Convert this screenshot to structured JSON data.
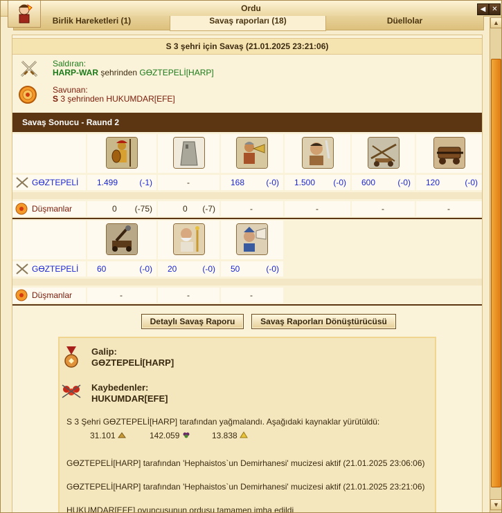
{
  "window": {
    "title": "Ordu"
  },
  "tabs": [
    {
      "label": "Birlik Hareketleri (1)"
    },
    {
      "label": "Savaş raporları (18)"
    },
    {
      "label": "Düellolar"
    }
  ],
  "report": {
    "title": "S 3 şehri için Savaş (21.01.2025 23:21:06)",
    "attacker": {
      "label": "Saldıran:",
      "player": "HARP-WAR",
      "mid": " şehrinden ",
      "target": "GӨZTEPELİ[HARP]"
    },
    "defender": {
      "label": "Savunan:",
      "city": "S",
      "line": " 3 şehrinden HUKUMDAR[EFE]"
    },
    "round_title": "Savaş Sonucu - Raund 2",
    "rows": {
      "player_name": "GӨZTEPELİ",
      "enemies_name": "Düşmanlar"
    },
    "units_row1": [
      {
        "icon": "spearman-icon",
        "own": "1.499",
        "own_loss": "(-1)",
        "enemy": "0",
        "enemy_loss": "(-75)"
      },
      {
        "icon": "wall-icon",
        "own": "-",
        "own_loss": "",
        "enemy": "0",
        "enemy_loss": "(-7)"
      },
      {
        "icon": "hornblower-icon",
        "own": "168",
        "own_loss": "(-0)",
        "enemy": "-",
        "enemy_loss": ""
      },
      {
        "icon": "swordsman-icon",
        "own": "1.500",
        "own_loss": "(-0)",
        "enemy": "-",
        "enemy_loss": ""
      },
      {
        "icon": "ballista-icon",
        "own": "600",
        "own_loss": "(-0)",
        "enemy": "-",
        "enemy_loss": ""
      },
      {
        "icon": "ram-icon",
        "own": "120",
        "own_loss": "(-0)",
        "enemy": "-",
        "enemy_loss": ""
      }
    ],
    "units_row2": [
      {
        "icon": "catapult-icon",
        "own": "60",
        "own_loss": "(-0)",
        "enemy": "-",
        "enemy_loss": ""
      },
      {
        "icon": "oracle-icon",
        "own": "20",
        "own_loss": "(-0)",
        "enemy": "-",
        "enemy_loss": ""
      },
      {
        "icon": "engineer-icon",
        "own": "50",
        "own_loss": "(-0)",
        "enemy": "-",
        "enemy_loss": ""
      }
    ],
    "buttons": {
      "detail": "Detaylı Savaş Raporu",
      "converter": "Savaş Raporları Dönüştürücüsü"
    },
    "result": {
      "winner_label": "Galip:",
      "winner": "GӨZTEPELİ[HARP]",
      "losers_label": "Kaybedenler:",
      "losers": "HUKUMDAR[EFE]",
      "plunder_text": "S 3 Şehri GӨZTEPELİ[HARP] tarafından yağmalandı. Aşağıdaki kaynaklar yürütüldü:",
      "resources": [
        {
          "value": "31.101",
          "icon": "grain-icon"
        },
        {
          "value": "142.059",
          "icon": "grapes-icon"
        },
        {
          "value": "13.838",
          "icon": "gold-icon"
        }
      ],
      "wonder1": "GӨZTEPELİ[HARP] tarafından 'Hephaistos`un Demirhanesi' mucizesi aktif (21.01.2025 23:06:06)",
      "wonder2": "GӨZTEPELİ[HARP] tarafından 'Hephaistos`un Demirhanesi' mucizesi aktif (21.01.2025 23:21:06)",
      "destroyed": "HUKUMDAR[EFE] oyuncusunun ordusu tamamen imha edildi"
    }
  }
}
